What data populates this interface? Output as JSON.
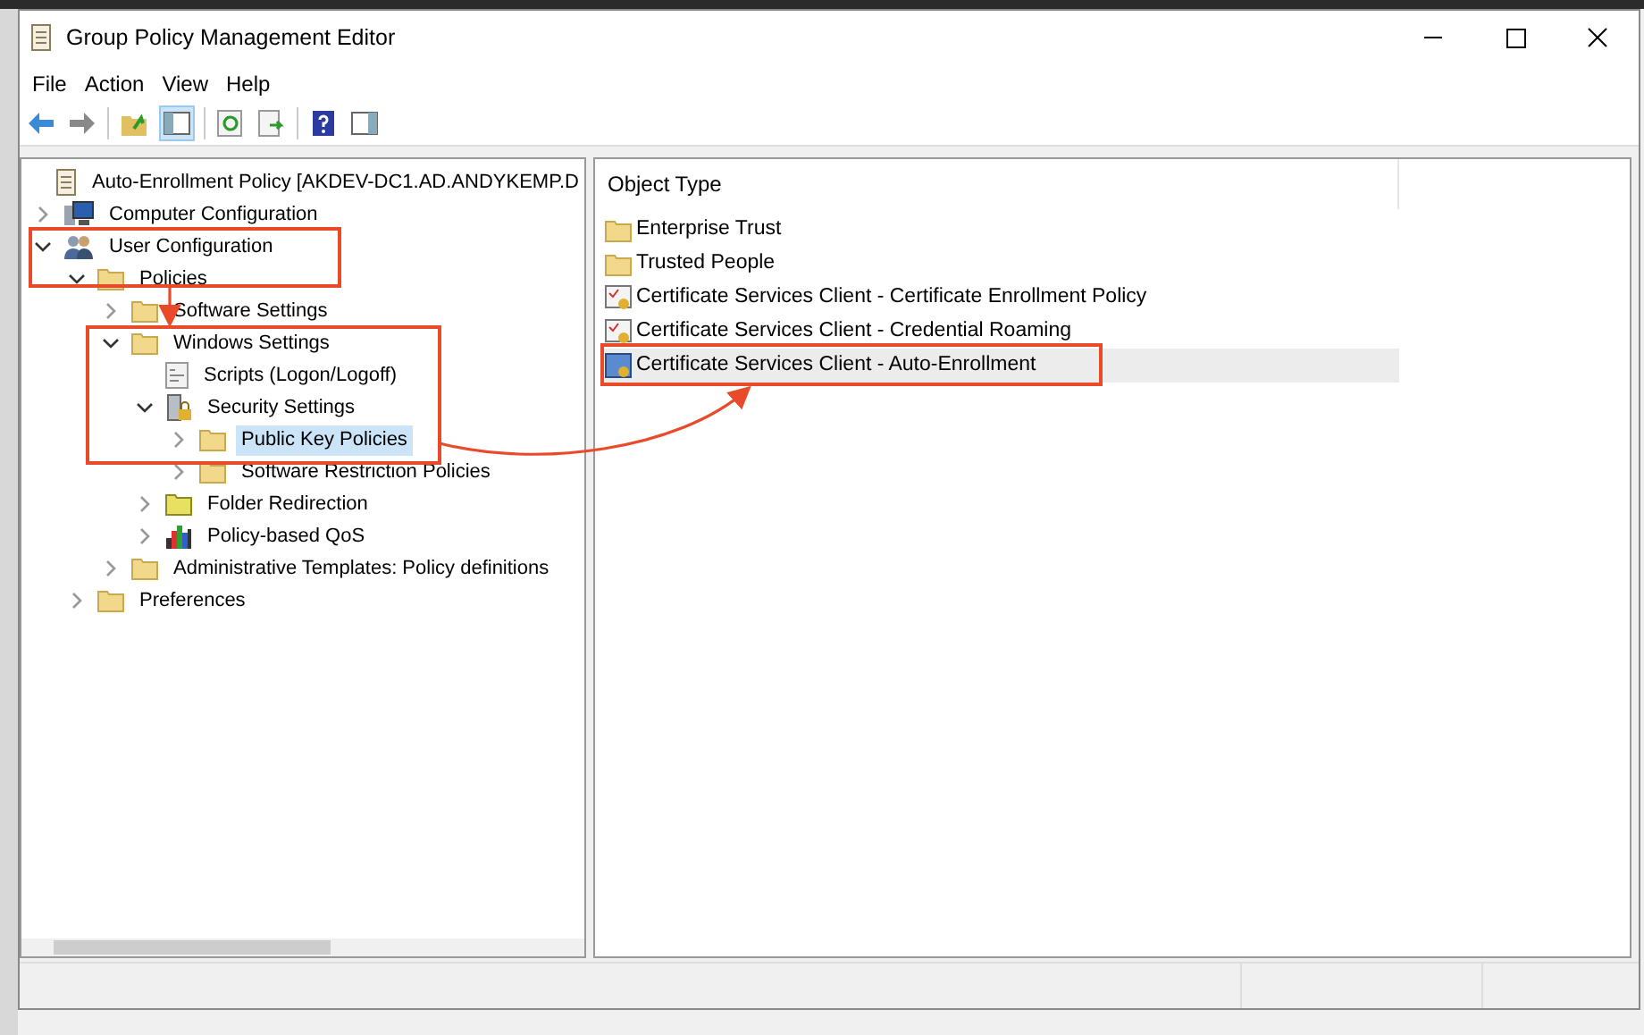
{
  "window": {
    "title": "Group Policy Management Editor"
  },
  "menu": [
    "File",
    "Action",
    "View",
    "Help"
  ],
  "tree": [
    {
      "label": "Auto-Enrollment Policy [AKDEV-DC1.AD.ANDYKEMP.D",
      "kind": "policy",
      "selected": false,
      "children": [
        {
          "label": "Computer Configuration",
          "kind": "computer",
          "expandable": true,
          "expanded": false,
          "selected": false
        },
        {
          "label": "User Configuration",
          "kind": "users",
          "expandable": true,
          "expanded": true,
          "selected": false,
          "children": [
            {
              "label": "Policies",
              "kind": "folder",
              "expandable": true,
              "expanded": true,
              "selected": false,
              "children": [
                {
                  "label": "Software Settings",
                  "kind": "folder",
                  "expandable": true,
                  "expanded": false,
                  "selected": false
                },
                {
                  "label": "Windows Settings",
                  "kind": "folder",
                  "expandable": true,
                  "expanded": true,
                  "selected": false,
                  "children": [
                    {
                      "label": "Scripts (Logon/Logoff)",
                      "kind": "script",
                      "selected": false
                    },
                    {
                      "label": "Security Settings",
                      "kind": "security",
                      "expandable": true,
                      "expanded": true,
                      "selected": false,
                      "children": [
                        {
                          "label": "Public Key Policies",
                          "kind": "folder",
                          "expandable": true,
                          "expanded": false,
                          "selected": true
                        },
                        {
                          "label": "Software Restriction Policies",
                          "kind": "folder",
                          "expandable": true,
                          "expanded": false,
                          "selected": false
                        }
                      ]
                    },
                    {
                      "label": "Folder Redirection",
                      "kind": "special-folder",
                      "expandable": true,
                      "expanded": false,
                      "selected": false
                    },
                    {
                      "label": "Policy-based QoS",
                      "kind": "chart",
                      "expandable": true,
                      "expanded": false,
                      "selected": false
                    }
                  ]
                },
                {
                  "label": "Administrative Templates: Policy definitions",
                  "kind": "folder",
                  "expandable": true,
                  "expanded": false,
                  "selected": false
                }
              ]
            },
            {
              "label": "Preferences",
              "kind": "folder",
              "expandable": true,
              "expanded": false,
              "selected": false
            }
          ]
        }
      ]
    }
  ],
  "list": {
    "column": "Object Type",
    "items": [
      {
        "label": "Enterprise Trust",
        "kind": "folder",
        "selected": false
      },
      {
        "label": "Trusted People",
        "kind": "folder",
        "selected": false
      },
      {
        "label": "Certificate Services Client - Certificate Enrollment Policy",
        "kind": "certificate",
        "selected": false
      },
      {
        "label": "Certificate Services Client - Credential Roaming",
        "kind": "certificate",
        "selected": false
      },
      {
        "label": "Certificate Services Client - Auto-Enrollment",
        "kind": "autoenroll",
        "selected": true
      }
    ]
  }
}
